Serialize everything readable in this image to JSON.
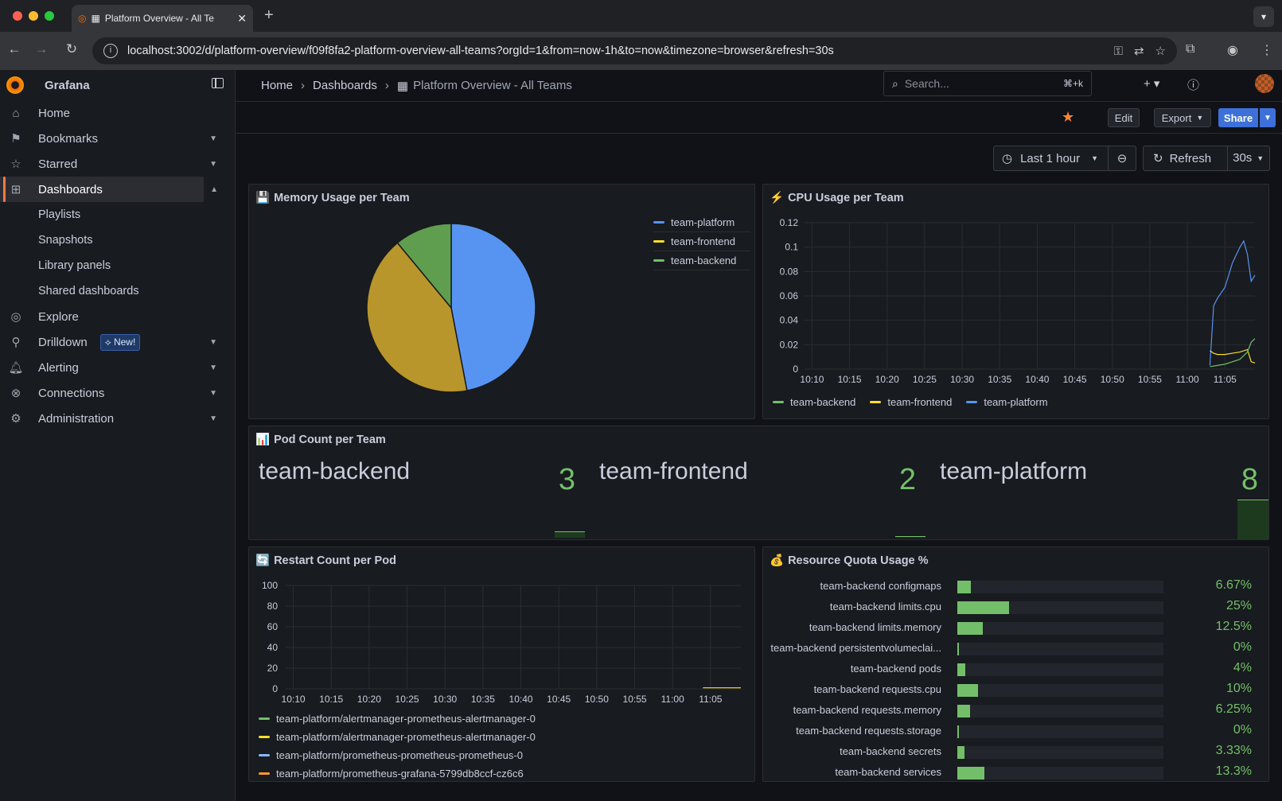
{
  "browser": {
    "tab_title": "Platform Overview - All Te",
    "url": "localhost:3002/d/platform-overview/f09f8fa2-platform-overview-all-teams?orgId=1&from=now-1h&to=now&timezone=browser&refresh=30s"
  },
  "sidebar": {
    "brand": "Grafana",
    "items": [
      {
        "label": "Home",
        "icon": "home-icon"
      },
      {
        "label": "Bookmarks",
        "icon": "bookmark-icon"
      },
      {
        "label": "Starred",
        "icon": "star-icon"
      },
      {
        "label": "Dashboards",
        "icon": "dashboards-icon"
      },
      {
        "label": "Explore",
        "icon": "compass-icon"
      },
      {
        "label": "Drilldown",
        "icon": "drilldown-icon",
        "badge": "New!"
      },
      {
        "label": "Alerting",
        "icon": "bell-icon"
      },
      {
        "label": "Connections",
        "icon": "connections-icon"
      },
      {
        "label": "Administration",
        "icon": "gear-icon"
      }
    ],
    "dashboard_subitems": [
      "Playlists",
      "Snapshots",
      "Library panels",
      "Shared dashboards"
    ]
  },
  "topnav": {
    "crumbs": [
      "Home",
      "Dashboards",
      "Platform Overview - All Teams"
    ],
    "search_placeholder": "Search...",
    "search_shortcut": "⌘+k"
  },
  "actions": {
    "edit": "Edit",
    "export": "Export",
    "share": "Share"
  },
  "timebar": {
    "range": "Last 1 hour",
    "refresh": "Refresh",
    "interval": "30s"
  },
  "panels": {
    "memory": {
      "title": "Memory Usage per Team",
      "emoji": "💾",
      "legend": [
        {
          "name": "team-platform",
          "color": "#5794f2"
        },
        {
          "name": "team-frontend",
          "color": "#fade2a"
        },
        {
          "name": "team-backend",
          "color": "#73bf69"
        }
      ]
    },
    "cpu": {
      "title": "CPU Usage per Team",
      "emoji": "⚡",
      "legend": [
        {
          "name": "team-backend",
          "color": "#73bf69"
        },
        {
          "name": "team-frontend",
          "color": "#fade2a"
        },
        {
          "name": "team-platform",
          "color": "#5794f2"
        }
      ]
    },
    "pods": {
      "title": "Pod Count per Team",
      "emoji": "📊",
      "stats": [
        {
          "name": "team-backend",
          "value": "3"
        },
        {
          "name": "team-frontend",
          "value": "2"
        },
        {
          "name": "team-platform",
          "value": "8"
        }
      ]
    },
    "restart": {
      "title": "Restart Count per Pod",
      "emoji": "🔄",
      "legend": [
        {
          "name": "team-platform/alertmanager-prometheus-alertmanager-0",
          "color": "#73bf69"
        },
        {
          "name": "team-platform/alertmanager-prometheus-alertmanager-0",
          "color": "#fade2a"
        },
        {
          "name": "team-platform/prometheus-prometheus-prometheus-0",
          "color": "#8ab8ff"
        },
        {
          "name": "team-platform/prometheus-grafana-5799db8ccf-cz6c6",
          "color": "#ff9830"
        }
      ]
    },
    "quota": {
      "title": "Resource Quota Usage %",
      "emoji": "💰",
      "rows": [
        {
          "label": "team-backend configmaps",
          "value": "6.67%",
          "fraction": 0.0667
        },
        {
          "label": "team-backend limits.cpu",
          "value": "25%",
          "fraction": 0.25
        },
        {
          "label": "team-backend limits.memory",
          "value": "12.5%",
          "fraction": 0.125
        },
        {
          "label": "team-backend persistentvolumeclai...",
          "value": "0%",
          "fraction": 0
        },
        {
          "label": "team-backend pods",
          "value": "4%",
          "fraction": 0.04
        },
        {
          "label": "team-backend requests.cpu",
          "value": "10%",
          "fraction": 0.1
        },
        {
          "label": "team-backend requests.memory",
          "value": "6.25%",
          "fraction": 0.0625
        },
        {
          "label": "team-backend requests.storage",
          "value": "0%",
          "fraction": 0
        },
        {
          "label": "team-backend secrets",
          "value": "3.33%",
          "fraction": 0.0333
        },
        {
          "label": "team-backend services",
          "value": "13.3%",
          "fraction": 0.133
        }
      ]
    }
  },
  "chart_data": [
    {
      "type": "pie",
      "title": "Memory Usage per Team",
      "categories": [
        "team-platform",
        "team-frontend",
        "team-backend"
      ],
      "values": [
        47,
        42,
        11
      ]
    },
    {
      "type": "line",
      "title": "CPU Usage per Team",
      "x_ticks": [
        "10:10",
        "10:15",
        "10:20",
        "10:25",
        "10:30",
        "10:35",
        "10:40",
        "10:45",
        "10:50",
        "10:55",
        "11:00",
        "11:05"
      ],
      "y_ticks": [
        "0",
        "0.02",
        "0.04",
        "0.06",
        "0.08",
        "0.1",
        "0.12"
      ],
      "ylim": [
        0,
        0.12
      ],
      "x_range_minutes": [
        "10:09",
        "11:09"
      ],
      "series": [
        {
          "name": "team-platform",
          "x": [
            "11:03",
            "11:03.5",
            "11:04",
            "11:05",
            "11:05.5",
            "11:06",
            "11:07",
            "11:07.5",
            "11:08",
            "11:08.5",
            "11:09"
          ],
          "values": [
            0.003,
            0.052,
            0.058,
            0.067,
            0.077,
            0.087,
            0.1,
            0.105,
            0.094,
            0.072,
            0.077
          ]
        },
        {
          "name": "team-frontend",
          "x": [
            "11:03",
            "11:03.5",
            "11:04",
            "11:05",
            "11:06",
            "11:07",
            "11:08",
            "11:08.5",
            "11:09"
          ],
          "values": [
            0.015,
            0.013,
            0.012,
            0.012,
            0.013,
            0.014,
            0.016,
            0.006,
            0.005
          ]
        },
        {
          "name": "team-backend",
          "x": [
            "11:03",
            "11:04",
            "11:05",
            "11:06",
            "11:07",
            "11:08",
            "11:08.5",
            "11:09"
          ],
          "values": [
            0.002,
            0.003,
            0.004,
            0.006,
            0.008,
            0.014,
            0.022,
            0.025
          ]
        }
      ]
    },
    {
      "type": "line",
      "title": "Restart Count per Pod",
      "x_ticks": [
        "10:10",
        "10:15",
        "10:20",
        "10:25",
        "10:30",
        "10:35",
        "10:40",
        "10:45",
        "10:50",
        "10:55",
        "11:00",
        "11:05"
      ],
      "y_ticks": [
        "0",
        "20",
        "40",
        "60",
        "80",
        "100"
      ],
      "ylim": [
        0,
        100
      ],
      "series": [
        {
          "name": "team-platform/alertmanager-prometheus-alertmanager-0",
          "x": [
            "11:04",
            "11:09"
          ],
          "values": [
            1,
            1
          ]
        }
      ]
    }
  ]
}
